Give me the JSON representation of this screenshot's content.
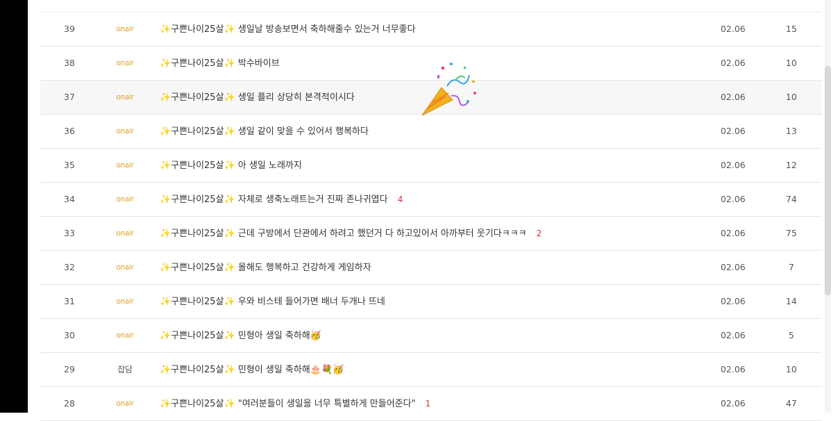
{
  "top_partial_text": "",
  "rows": [
    {
      "num": "39",
      "category": "onair",
      "prefix": "✨구쁜나이25살✨",
      "title": "생일날 방송보면서 축하해줄수 있는거 너무좋다",
      "comments": "",
      "date": "02.06",
      "views": "15"
    },
    {
      "num": "38",
      "category": "onair",
      "prefix": "✨구쁜나이25살✨",
      "title": "박수바이브",
      "comments": "",
      "date": "02.06",
      "views": "10"
    },
    {
      "num": "37",
      "category": "onair",
      "prefix": "✨구쁜나이25살✨",
      "title": "생일 플리 상당히 본격적이시다",
      "comments": "",
      "date": "02.06",
      "views": "10"
    },
    {
      "num": "36",
      "category": "onair",
      "prefix": "✨구쁜나이25살✨",
      "title": "생일 같이 맞을 수 있어서 행복하다",
      "comments": "",
      "date": "02.06",
      "views": "13"
    },
    {
      "num": "35",
      "category": "onair",
      "prefix": "✨구쁜나이25살✨",
      "title": "아 생일 노래까지",
      "comments": "",
      "date": "02.06",
      "views": "12"
    },
    {
      "num": "34",
      "category": "onair",
      "prefix": "✨구쁜나이25살✨",
      "title": "자체로 생축노래트는거 진짜 존나귀엽다",
      "comments": "4",
      "date": "02.06",
      "views": "74"
    },
    {
      "num": "33",
      "category": "onair",
      "prefix": "✨구쁜나이25살✨",
      "title": "근데 구방에서 단관에서 하려고 했던거 다 하고있어서 아까부터 웃기다ㅋㅋㅋ",
      "comments": "2",
      "date": "02.06",
      "views": "75"
    },
    {
      "num": "32",
      "category": "onair",
      "prefix": "✨구쁜나이25살✨",
      "title": "올해도 행복하고 건강하게 게임하자",
      "comments": "",
      "date": "02.06",
      "views": "7"
    },
    {
      "num": "31",
      "category": "onair",
      "prefix": "✨구쁜나이25살✨",
      "title": "우와 비스테 들어가면 배너 두개나 뜨네",
      "comments": "",
      "date": "02.06",
      "views": "14"
    },
    {
      "num": "30",
      "category": "onair",
      "prefix": "✨구쁜나이25살✨",
      "title": "민형아 생일 축하해🥳",
      "comments": "",
      "date": "02.06",
      "views": "5"
    },
    {
      "num": "29",
      "category": "잡담",
      "prefix": "✨구쁜나이25살✨",
      "title": "민형이 생일 축하해🎂💐🥳",
      "comments": "",
      "date": "02.06",
      "views": "10"
    },
    {
      "num": "28",
      "category": "onair",
      "prefix": "✨구쁜나이25살✨",
      "title": "\"여러분들이 생일을 너무 특별하게 만들어준다\"",
      "comments": "1",
      "date": "02.06",
      "views": "47"
    }
  ],
  "sticker": "party-popper",
  "colors": {
    "category_onair": "#e0a12c",
    "comment_count": "#d32f2f",
    "row_highlight": "#f7f7f7"
  }
}
